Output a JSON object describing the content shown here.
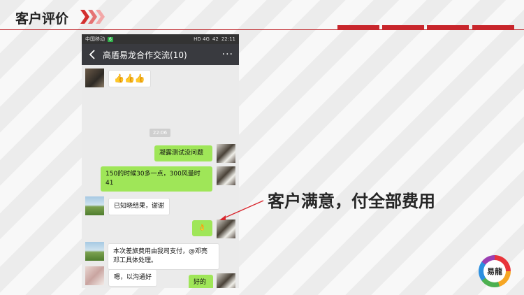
{
  "header": {
    "title": "客户评价",
    "accent_color": "#c8262c"
  },
  "phone": {
    "status": {
      "carrier": "中国移动",
      "badge": "6",
      "signal": "HD 4G",
      "battery": "42",
      "time": "22:11"
    },
    "nav": {
      "title": "高盾易龙合作交流(10)",
      "more": "···"
    },
    "timestamp": "22:06",
    "messages": [
      {
        "side": "in",
        "text": "👍👍👍"
      },
      {
        "side": "out",
        "text": "凝露测试没问题"
      },
      {
        "side": "out",
        "text": "150的时候30多一点，300风量时41"
      },
      {
        "side": "in",
        "text": "已知晓结果，谢谢"
      },
      {
        "side": "out",
        "text": "👌"
      },
      {
        "side": "in",
        "text": "本次差旅费用由我司支付，@邓亮 邓工具体处理。"
      },
      {
        "side": "out",
        "text": "好的"
      },
      {
        "side": "in",
        "text": "嗯，以沟通好"
      }
    ]
  },
  "callout": {
    "text": "客户满意，付全部费用",
    "arrow_color": "#d8262d"
  },
  "logo": {
    "text": "易龍"
  }
}
